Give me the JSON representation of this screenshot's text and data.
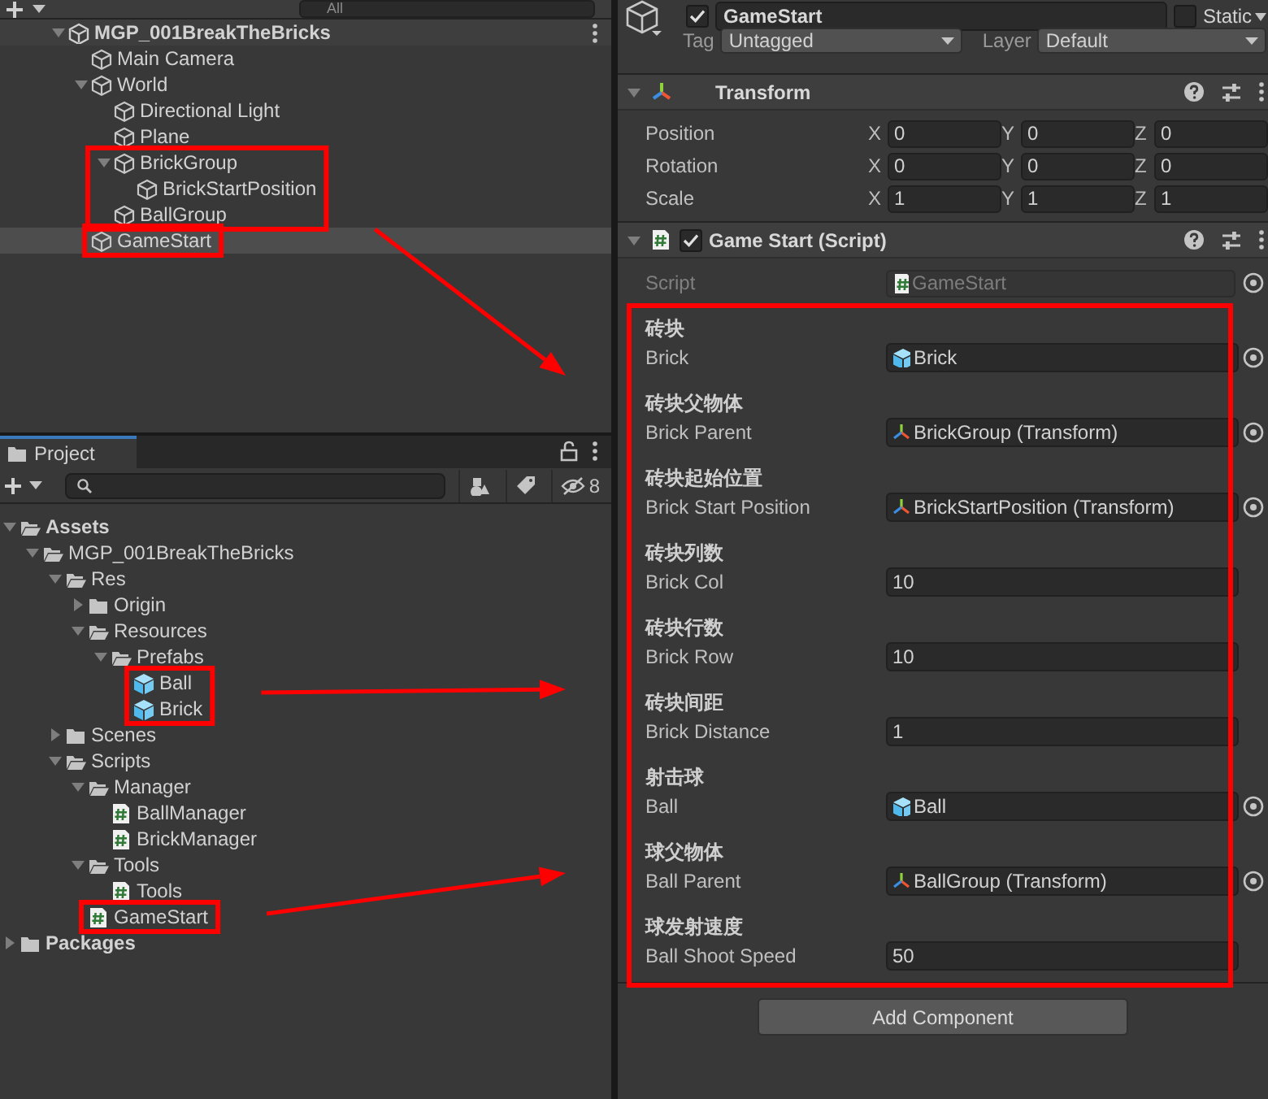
{
  "hierarchy": {
    "search_placeholder": "All",
    "items": [
      {
        "kind": "scene",
        "label": "MGP_001BreakTheBricks",
        "expanded": true,
        "selected": false,
        "marked": false,
        "children": [
          {
            "kind": "object",
            "label": "Main Camera",
            "selected": false,
            "marked": false
          },
          {
            "kind": "object",
            "label": "World",
            "expanded": true,
            "selected": false,
            "marked": false,
            "children": [
              {
                "kind": "object",
                "label": "Directional Light",
                "selected": false,
                "marked": false
              },
              {
                "kind": "object",
                "label": "Plane",
                "selected": false,
                "marked": false
              },
              {
                "kind": "object",
                "label": "BrickGroup",
                "expanded": true,
                "selected": false,
                "marked": true,
                "arrow": true,
                "children": [
                  {
                    "kind": "object",
                    "label": "BrickStartPosition",
                    "selected": false,
                    "marked": true
                  }
                ]
              },
              {
                "kind": "object",
                "label": "BallGroup",
                "selected": false,
                "marked": true
              }
            ]
          },
          {
            "kind": "object",
            "label": "GameStart",
            "selected": true,
            "marked": true,
            "arrow": false
          }
        ]
      }
    ]
  },
  "project": {
    "tab": "Project",
    "hidden_count": "8",
    "items": [
      {
        "kind": "folder",
        "label": "Assets",
        "expanded": true,
        "marked": false,
        "children": [
          {
            "kind": "folder",
            "label": "MGP_001BreakTheBricks",
            "expanded": true,
            "marked": false,
            "children": [
              {
                "kind": "folder",
                "label": "Res",
                "expanded": true,
                "marked": false,
                "children": [
                  {
                    "kind": "folder",
                    "label": "Origin",
                    "expanded": false,
                    "marked": false
                  },
                  {
                    "kind": "folder",
                    "label": "Resources",
                    "expanded": true,
                    "marked": false,
                    "children": [
                      {
                        "kind": "folder",
                        "label": "Prefabs",
                        "expanded": true,
                        "marked": false,
                        "children": [
                          {
                            "kind": "prefab",
                            "label": "Ball",
                            "marked": true,
                            "arrow": true
                          },
                          {
                            "kind": "prefab",
                            "label": "Brick",
                            "marked": true
                          }
                        ]
                      }
                    ]
                  }
                ]
              },
              {
                "kind": "folder",
                "label": "Scenes",
                "expanded": false,
                "marked": false
              },
              {
                "kind": "folder",
                "label": "Scripts",
                "expanded": true,
                "marked": false,
                "children": [
                  {
                    "kind": "folder",
                    "label": "Manager",
                    "expanded": true,
                    "marked": false,
                    "children": [
                      {
                        "kind": "script",
                        "label": "BallManager",
                        "marked": false
                      },
                      {
                        "kind": "script",
                        "label": "BrickManager",
                        "marked": false
                      }
                    ]
                  },
                  {
                    "kind": "folder",
                    "label": "Tools",
                    "expanded": true,
                    "marked": false,
                    "children": [
                      {
                        "kind": "script",
                        "label": "Tools",
                        "marked": false
                      }
                    ]
                  },
                  {
                    "kind": "script",
                    "label": "GameStart",
                    "marked": true,
                    "arrow": true
                  }
                ]
              }
            ]
          }
        ]
      },
      {
        "kind": "folder",
        "label": "Packages",
        "expanded": false,
        "marked": false
      }
    ]
  },
  "inspector": {
    "object": {
      "active": true,
      "name": "GameStart",
      "static": false,
      "static_label": "Static",
      "tag_label": "Tag",
      "tag": "Untagged",
      "layer_label": "Layer",
      "layer": "Default"
    },
    "transform": {
      "title": "Transform",
      "expanded": true,
      "rows": [
        {
          "label": "Position",
          "axes": [
            {
              "axis": "X",
              "value": "0"
            },
            {
              "axis": "Y",
              "value": "0"
            },
            {
              "axis": "Z",
              "value": "0"
            }
          ]
        },
        {
          "label": "Rotation",
          "axes": [
            {
              "axis": "X",
              "value": "0"
            },
            {
              "axis": "Y",
              "value": "0"
            },
            {
              "axis": "Z",
              "value": "0"
            }
          ]
        },
        {
          "label": "Scale",
          "axes": [
            {
              "axis": "X",
              "value": "1"
            },
            {
              "axis": "Y",
              "value": "1"
            },
            {
              "axis": "Z",
              "value": "1"
            }
          ]
        }
      ]
    },
    "script": {
      "title": "Game Start (Script)",
      "enabled": true,
      "expanded": true,
      "script_label": "Script",
      "script_value": "GameStart",
      "marked": true,
      "fields": [
        {
          "caption": "砖块",
          "label": "Brick",
          "kind": "prefab",
          "value": "Brick"
        },
        {
          "caption": "砖块父物体",
          "label": "Brick Parent",
          "kind": "transform",
          "value": "BrickGroup (Transform)"
        },
        {
          "caption": "砖块起始位置",
          "label": "Brick Start Position",
          "kind": "transform",
          "value": "BrickStartPosition (Transform)"
        },
        {
          "caption": "砖块列数",
          "label": "Brick Col",
          "kind": "number",
          "value": "10"
        },
        {
          "caption": "砖块行数",
          "label": "Brick Row",
          "kind": "number",
          "value": "10"
        },
        {
          "caption": "砖块间距",
          "label": "Brick Distance",
          "kind": "number",
          "value": "1"
        },
        {
          "caption": "射击球",
          "label": "Ball",
          "kind": "prefab",
          "value": "Ball"
        },
        {
          "caption": "球父物体",
          "label": "Ball Parent",
          "kind": "transform",
          "value": "BallGroup (Transform)"
        },
        {
          "caption": "球发射速度",
          "label": "Ball Shoot Speed",
          "kind": "number",
          "value": "50"
        }
      ]
    },
    "add_component": "Add Component"
  }
}
